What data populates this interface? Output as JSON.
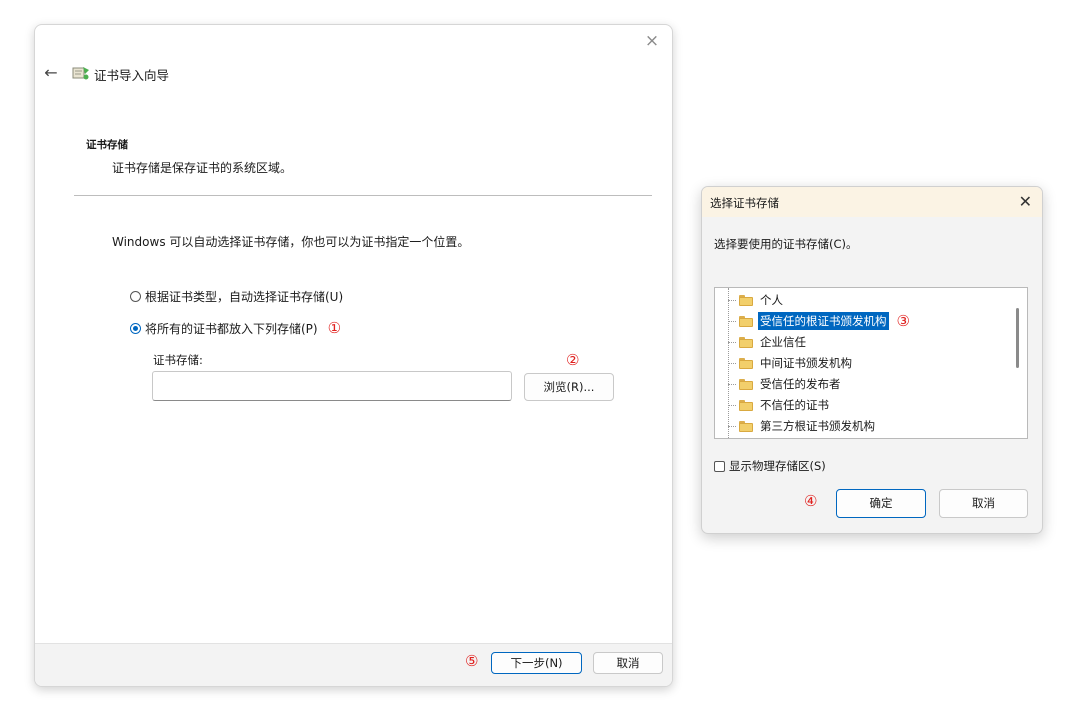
{
  "wizard": {
    "title": "证书导入向导",
    "close_icon": "×",
    "back_icon": "←",
    "section_title": "证书存储",
    "section_desc": "证书存储是保存证书的系统区域。",
    "intro": "Windows 可以自动选择证书存储，你也可以为证书指定一个位置。",
    "options": [
      {
        "label": "根据证书类型，自动选择证书存储(U)",
        "checked": false
      },
      {
        "label": "将所有的证书都放入下列存储(P)",
        "checked": true
      }
    ],
    "store_label": "证书存储:",
    "store_value": "",
    "browse_label": "浏览(R)...",
    "next_label": "下一步(N)",
    "cancel_label": "取消"
  },
  "dialog": {
    "title": "选择证书存储",
    "close_icon": "✕",
    "prompt": "选择要使用的证书存储(C)。",
    "items": [
      {
        "label": "个人",
        "selected": false
      },
      {
        "label": "受信任的根证书颁发机构",
        "selected": true
      },
      {
        "label": "企业信任",
        "selected": false
      },
      {
        "label": "中间证书颁发机构",
        "selected": false
      },
      {
        "label": "受信任的发布者",
        "selected": false
      },
      {
        "label": "不信任的证书",
        "selected": false
      },
      {
        "label": "第三方根证书颁发机构",
        "selected": false
      }
    ],
    "show_physical_label": "显示物理存储区(S)",
    "show_physical_checked": false,
    "ok_label": "确定",
    "cancel_label": "取消"
  },
  "markers": {
    "m1": "①",
    "m2": "②",
    "m3": "③",
    "m4": "④",
    "m5": "⑤"
  },
  "colors": {
    "accent": "#0067c0",
    "marker": "#e0201e",
    "dialog_titlebar": "#fbf3e4"
  }
}
